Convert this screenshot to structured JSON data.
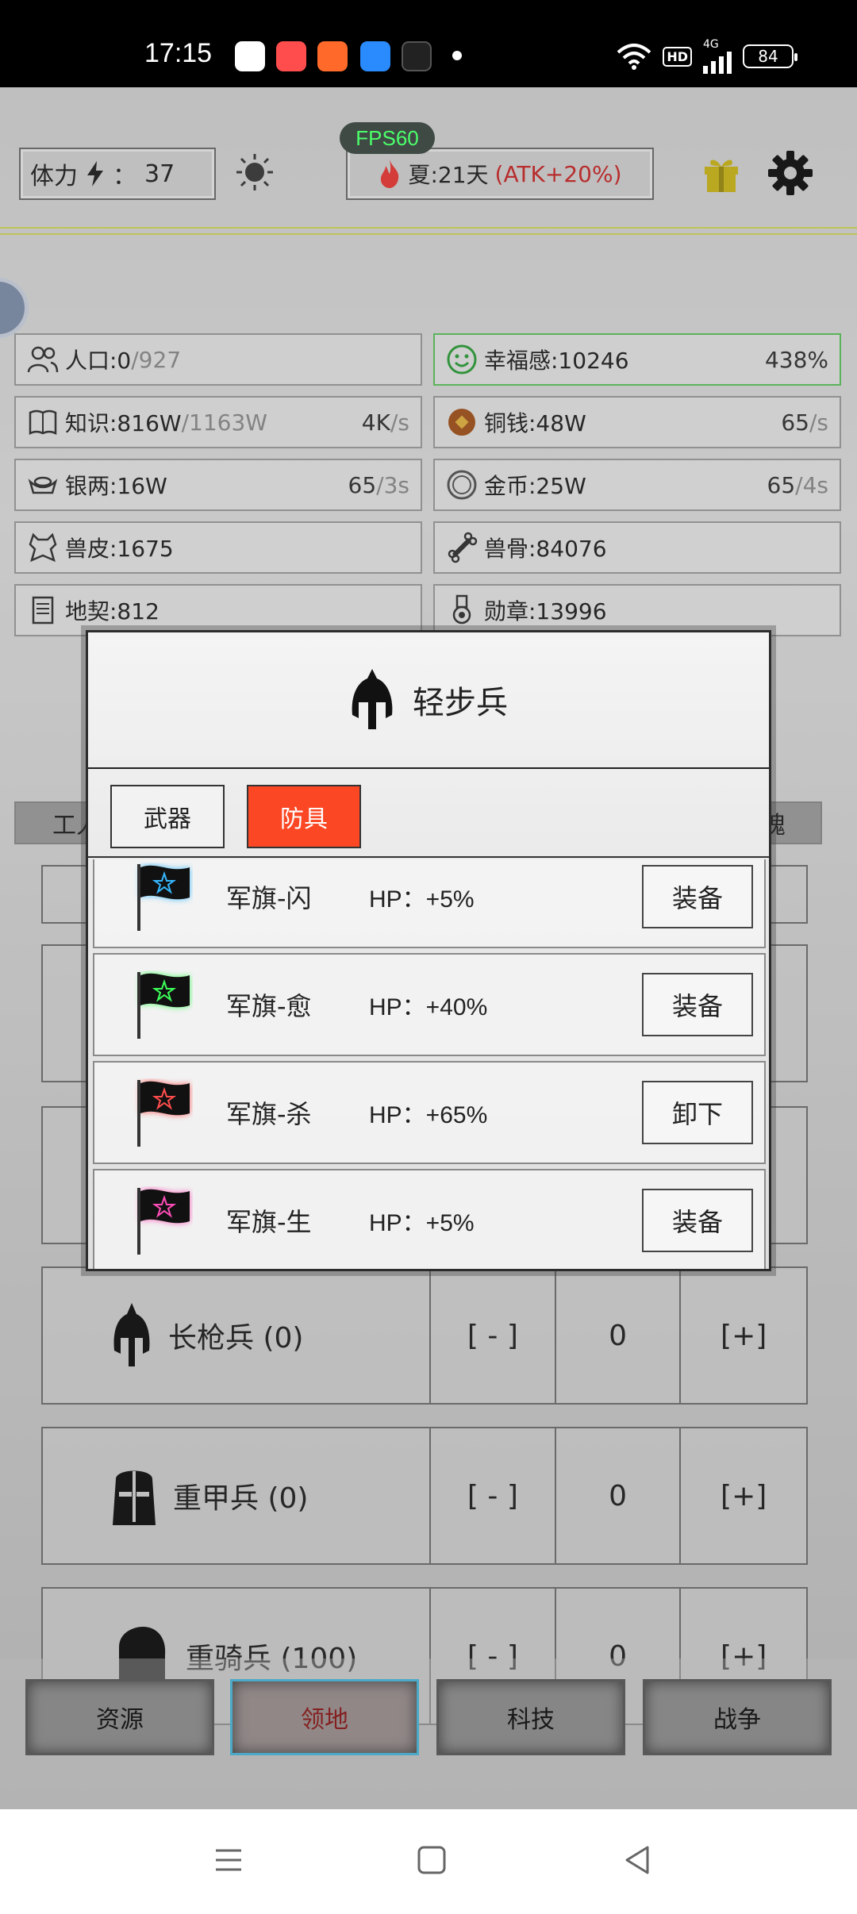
{
  "status_bar": {
    "time": "17:15",
    "network": "4G",
    "hd": "HD",
    "battery": "84",
    "app_colors": [
      "#ffffff",
      "#ff4d4d",
      "#ff6a2a",
      "#2a8bff",
      "#222222"
    ]
  },
  "hud": {
    "fps": "FPS60",
    "stamina_label": "体力",
    "stamina_sep": "：",
    "stamina_value": "37",
    "season": "夏:21天",
    "season_bonus": "(ATK+20%)"
  },
  "resources": [
    {
      "icon": "people-icon",
      "label": "人口:0",
      "label_extra": "/927",
      "rate": "",
      "rate_unit": "",
      "green": false
    },
    {
      "icon": "smile-icon",
      "label": "幸福感:10246",
      "label_extra": "",
      "rate": "438%",
      "rate_unit": "",
      "green": true
    },
    {
      "icon": "book-icon",
      "label": "知识:816W",
      "label_extra": "/1163W",
      "rate": "4K",
      "rate_unit": "/s",
      "green": false
    },
    {
      "icon": "copper-coin-icon",
      "label": "铜钱:48W",
      "label_extra": "",
      "rate": "65",
      "rate_unit": "/s",
      "green": false
    },
    {
      "icon": "silver-ingot-icon",
      "label": "银两:16W",
      "label_extra": "",
      "rate": "65",
      "rate_unit": "/3s",
      "green": false
    },
    {
      "icon": "gold-coin-icon",
      "label": "金币:25W",
      "label_extra": "",
      "rate": "65",
      "rate_unit": "/4s",
      "green": false
    },
    {
      "icon": "beast-hide-icon",
      "label": "兽皮:1675",
      "label_extra": "",
      "rate": "",
      "rate_unit": "",
      "green": false
    },
    {
      "icon": "bone-icon",
      "label": "兽骨:84076",
      "label_extra": "",
      "rate": "",
      "rate_unit": "",
      "green": false
    },
    {
      "icon": "deed-icon",
      "label": "地契:812",
      "label_extra": "",
      "rate": "",
      "rate_unit": "",
      "green": false
    },
    {
      "icon": "medal-icon",
      "label": "勋章:13996",
      "label_extra": "",
      "rate": "",
      "rate_unit": "",
      "green": false
    }
  ],
  "tabstrip": {
    "left_label": "工人",
    "right_label": "魄"
  },
  "units": [
    {
      "icon": "spearman-helmet-icon",
      "name": "长枪兵 (0)",
      "minus": "[ - ]",
      "count": "0",
      "plus": "[+]"
    },
    {
      "icon": "heavy-helmet-icon",
      "name": "重甲兵 (0)",
      "minus": "[ - ]",
      "count": "0",
      "plus": "[+]"
    },
    {
      "icon": "cavalry-helmet-icon",
      "name": "重骑兵 (100)",
      "minus": "[ - ]",
      "count": "0",
      "plus": "[+]"
    }
  ],
  "bottom_nav": [
    {
      "label": "资源",
      "active": false
    },
    {
      "label": "领地",
      "active": true
    },
    {
      "label": "科技",
      "active": false
    },
    {
      "label": "战争",
      "active": false
    }
  ],
  "dialog": {
    "title": "轻步兵",
    "tabs": [
      {
        "label": "武器",
        "active": false
      },
      {
        "label": "防具",
        "active": true
      }
    ],
    "items": [
      {
        "name": "军旗-闪",
        "stat": "HP：+5%",
        "action": "装备",
        "glow": "#36b7ff"
      },
      {
        "name": "军旗-愈",
        "stat": "HP：+40%",
        "action": "装备",
        "glow": "#3dff5a"
      },
      {
        "name": "军旗-杀",
        "stat": "HP：+65%",
        "action": "卸下",
        "glow": "#ff4d4d"
      },
      {
        "name": "军旗-生",
        "stat": "HP：+5%",
        "action": "装备",
        "glow": "#ff4db8"
      }
    ]
  },
  "colors": {
    "accent_red": "#fb4724",
    "fps_green": "#4cff6a",
    "active_nav_border": "#4bb6d8",
    "atk_red": "#c62828"
  }
}
